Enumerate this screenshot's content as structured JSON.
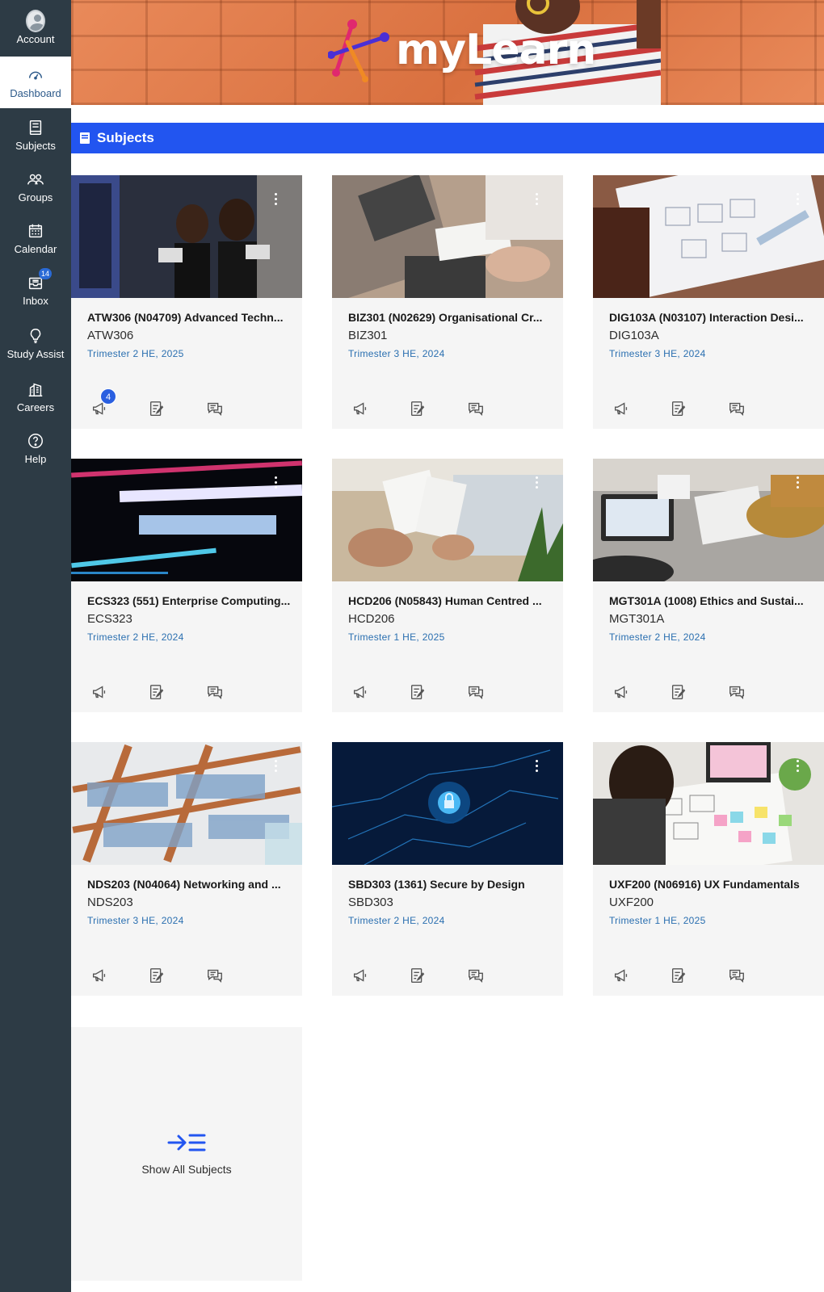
{
  "sidebar": {
    "items": [
      {
        "label": "Account",
        "icon": "account-avatar-icon"
      },
      {
        "label": "Dashboard",
        "icon": "dashboard-icon",
        "active": true
      },
      {
        "label": "Subjects",
        "icon": "subjects-book-icon"
      },
      {
        "label": "Groups",
        "icon": "groups-icon"
      },
      {
        "label": "Calendar",
        "icon": "calendar-icon"
      },
      {
        "label": "Inbox",
        "icon": "inbox-icon",
        "badge": "14"
      },
      {
        "label": "Study Assist",
        "icon": "lightbulb-icon"
      },
      {
        "label": "Careers",
        "icon": "careers-building-icon"
      },
      {
        "label": "Help",
        "icon": "help-icon"
      }
    ]
  },
  "banner": {
    "logo_text": "myLearn"
  },
  "section": {
    "title": "Subjects"
  },
  "colors": {
    "sidebar": "#2d3b45",
    "accent": "#2255f0",
    "term": "#2a6fb0"
  },
  "cards": [
    {
      "title": "ATW306 (N04709) Advanced Techn...",
      "code": "ATW306",
      "term": "Trimester 2 HE, 2025",
      "announcement_badge": "4"
    },
    {
      "title": "BIZ301 (N02629) Organisational Cr...",
      "code": "BIZ301",
      "term": "Trimester 3 HE, 2024"
    },
    {
      "title": "DIG103A (N03107) Interaction Desi...",
      "code": "DIG103A",
      "term": "Trimester 3 HE, 2024"
    },
    {
      "title": "ECS323 (551) Enterprise Computing...",
      "code": "ECS323",
      "term": "Trimester 2 HE, 2024"
    },
    {
      "title": "HCD206 (N05843) Human Centred ...",
      "code": "HCD206",
      "term": "Trimester 1 HE, 2025"
    },
    {
      "title": "MGT301A (1008) Ethics and Sustai...",
      "code": "MGT301A",
      "term": "Trimester 2 HE, 2024"
    },
    {
      "title": "NDS203 (N04064) Networking and ...",
      "code": "NDS203",
      "term": "Trimester 3 HE, 2024"
    },
    {
      "title": "SBD303 (1361) Secure by Design",
      "code": "SBD303",
      "term": "Trimester 2 HE, 2024"
    },
    {
      "title": "UXF200 (N06916) UX Fundamentals",
      "code": "UXF200",
      "term": "Trimester 1 HE, 2025"
    }
  ],
  "show_all": {
    "label": "Show All Subjects"
  }
}
